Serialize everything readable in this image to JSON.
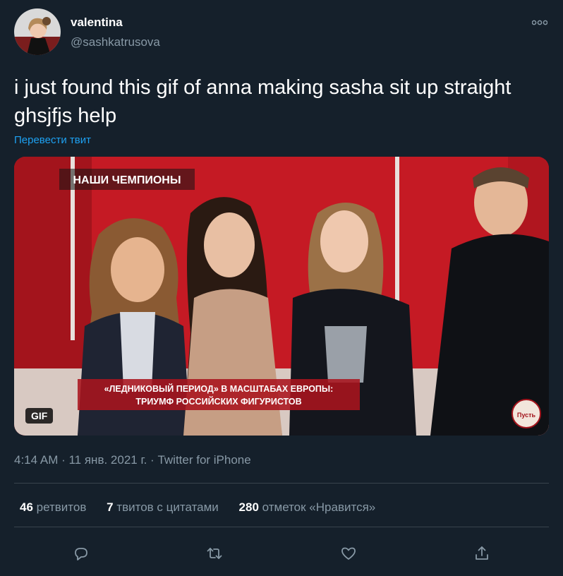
{
  "author": {
    "name": "valentina",
    "handle": "@sashkatrusova"
  },
  "tweet": {
    "text": "i just found this gif of anna making sasha sit up straight ghsjfjs help",
    "translate_label": "Перевести твит"
  },
  "media": {
    "badge": "GIF",
    "banner_top": "НАШИ ЧЕМПИОНЫ",
    "caption_line1": "«ЛЕДНИКОВЫЙ ПЕРИОД» В МАСШТАБАХ ЕВРОПЫ:",
    "caption_line2": "ТРИУМФ РОССИЙСКИХ ФИГУРИСТОВ",
    "logo_text": "Пусть"
  },
  "meta": {
    "time": "4:14 AM",
    "sep1": " · ",
    "date": "11 янв. 2021 г.",
    "sep2": " · ",
    "source": "Twitter for iPhone"
  },
  "stats": {
    "retweets_count": "46",
    "retweets_label": " ретвитов",
    "quotes_count": "7",
    "quotes_label": " твитов с цитатами",
    "likes_count": "280",
    "likes_label": " отметок «Нравится»"
  },
  "actions": [
    "reply-icon",
    "retweet-icon",
    "like-icon",
    "share-icon"
  ],
  "colors": {
    "background": "#15202b",
    "secondary_text": "#8899a6",
    "link": "#1da1f2",
    "divider": "#38444d"
  }
}
